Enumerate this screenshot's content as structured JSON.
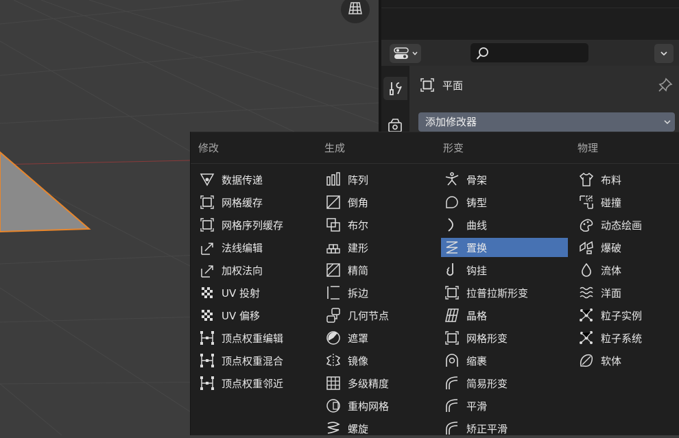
{
  "properties": {
    "object_name": "平面",
    "add_modifier_label": "添加修改器"
  },
  "menu": {
    "columns": [
      {
        "title": "修改",
        "items": [
          {
            "label": "数据传递",
            "icon": "data-transfer-icon"
          },
          {
            "label": "网格缓存",
            "icon": "mesh-cache-icon"
          },
          {
            "label": "网格序列缓存",
            "icon": "mesh-sequence-cache-icon"
          },
          {
            "label": "法线编辑",
            "icon": "normal-edit-icon"
          },
          {
            "label": "加权法向",
            "icon": "weighted-normal-icon"
          },
          {
            "label": "UV 投射",
            "icon": "uv-project-icon"
          },
          {
            "label": "UV 偏移",
            "icon": "uv-warp-icon"
          },
          {
            "label": "顶点权重编辑",
            "icon": "vertex-weight-icon"
          },
          {
            "label": "顶点权重混合",
            "icon": "vertex-weight-icon"
          },
          {
            "label": "顶点权重邻近",
            "icon": "vertex-weight-icon"
          }
        ]
      },
      {
        "title": "生成",
        "items": [
          {
            "label": "阵列",
            "icon": "array-icon"
          },
          {
            "label": "倒角",
            "icon": "bevel-icon"
          },
          {
            "label": "布尔",
            "icon": "boolean-icon"
          },
          {
            "label": "建形",
            "icon": "build-icon"
          },
          {
            "label": "精简",
            "icon": "decimate-icon"
          },
          {
            "label": "拆边",
            "icon": "edge-split-icon"
          },
          {
            "label": "几何节点",
            "icon": "geometry-nodes-icon"
          },
          {
            "label": "遮罩",
            "icon": "mask-icon"
          },
          {
            "label": "镜像",
            "icon": "mirror-icon"
          },
          {
            "label": "多级精度",
            "icon": "multires-icon"
          },
          {
            "label": "重构网格",
            "icon": "remesh-icon"
          },
          {
            "label": "螺旋",
            "icon": "screw-icon"
          }
        ]
      },
      {
        "title": "形变",
        "items": [
          {
            "label": "骨架",
            "icon": "armature-icon"
          },
          {
            "label": "铸型",
            "icon": "cast-icon"
          },
          {
            "label": "曲线",
            "icon": "curve-icon"
          },
          {
            "label": "置换",
            "icon": "displace-icon"
          },
          {
            "label": "钩挂",
            "icon": "hook-icon"
          },
          {
            "label": "拉普拉斯形变",
            "icon": "laplacian-deform-icon"
          },
          {
            "label": "晶格",
            "icon": "lattice-icon"
          },
          {
            "label": "网格形变",
            "icon": "mesh-deform-icon"
          },
          {
            "label": "缩裹",
            "icon": "shrinkwrap-icon"
          },
          {
            "label": "简易形变",
            "icon": "simple-deform-icon"
          },
          {
            "label": "平滑",
            "icon": "smooth-icon"
          },
          {
            "label": "矫正平滑",
            "icon": "corrective-smooth-icon"
          }
        ]
      },
      {
        "title": "物理",
        "items": [
          {
            "label": "布料",
            "icon": "cloth-icon"
          },
          {
            "label": "碰撞",
            "icon": "collision-icon"
          },
          {
            "label": "动态绘画",
            "icon": "dynamic-paint-icon"
          },
          {
            "label": "爆破",
            "icon": "explode-icon"
          },
          {
            "label": "流体",
            "icon": "fluid-icon"
          },
          {
            "label": "洋面",
            "icon": "ocean-icon"
          },
          {
            "label": "粒子实例",
            "icon": "particle-instance-icon"
          },
          {
            "label": "粒子系统",
            "icon": "particle-system-icon"
          },
          {
            "label": "软体",
            "icon": "soft-body-icon"
          }
        ]
      }
    ],
    "highlighted": "置换"
  },
  "colors": {
    "highlight": "#4772b3",
    "selection_outline": "#e8862c",
    "menu_bg": "#1f1f1f"
  }
}
